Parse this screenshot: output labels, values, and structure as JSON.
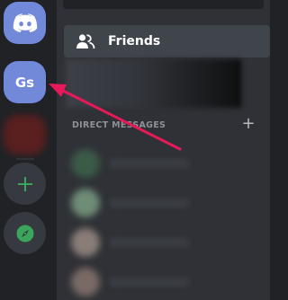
{
  "server_rail": {
    "home_icon": "discord-logo-icon",
    "selected_server_initials": "Gs",
    "add_server_icon": "plus-icon",
    "explore_icon": "compass-icon"
  },
  "sidebar": {
    "friends_label": "Friends",
    "friends_icon": "friends-icon",
    "direct_messages_header": "DIRECT MESSAGES",
    "add_dm_icon": "plus-icon",
    "add_dm_label": "+"
  },
  "colors": {
    "blurple": "#7289da",
    "rail_bg": "#202225",
    "sidebar_bg": "#2f3136",
    "arrow": "#e8195a",
    "green": "#3ba55c"
  },
  "dm_avatar_colors": [
    "#3b5b48",
    "#6f8c77",
    "#8a7d78",
    "#7a6a66"
  ]
}
